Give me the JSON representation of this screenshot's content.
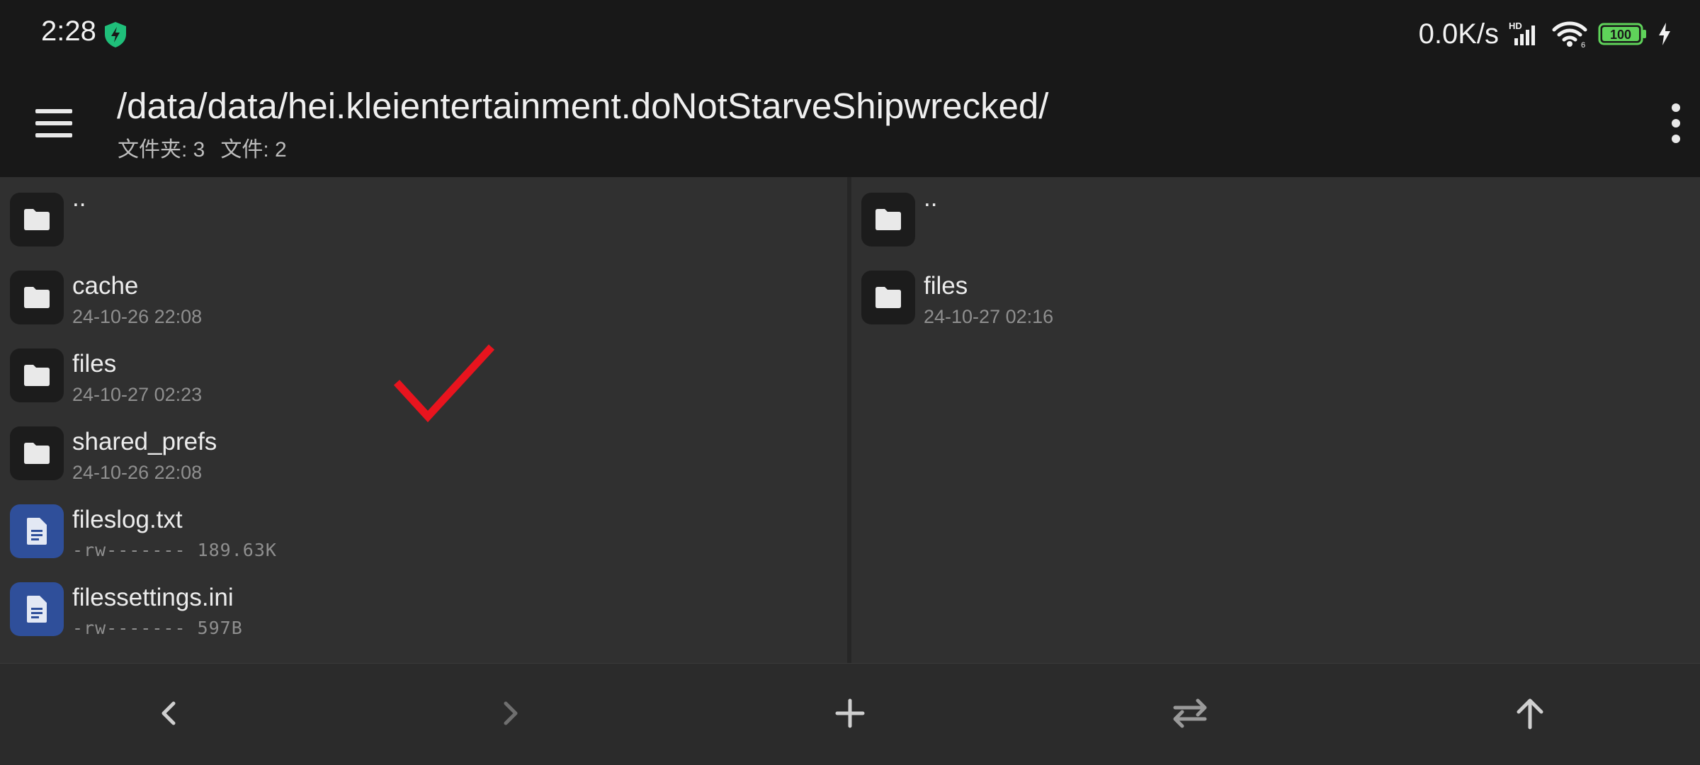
{
  "status_bar": {
    "time": "2:28",
    "shield_icon": "shield-bolt-icon",
    "network_speed": "0.0K/s",
    "signal_label": "HD",
    "battery_level": "100",
    "colors": {
      "shield": "#1fbf7a",
      "battery": "#5fd35a"
    }
  },
  "toolbar": {
    "menu_icon": "hamburger-menu-icon",
    "path": "/data/data/hei.kleientertainment.doNotStarveShipwrecked/",
    "folder_count": "文件夹: 3",
    "file_count": "文件: 2",
    "overflow_icon": "more-vertical-icon"
  },
  "left_pane": {
    "items": [
      {
        "name": "..",
        "meta": "",
        "type": "folder"
      },
      {
        "name": "cache",
        "meta": "24-10-26 22:08",
        "type": "folder"
      },
      {
        "name": "files",
        "meta": "24-10-27 02:23",
        "type": "folder"
      },
      {
        "name": "shared_prefs",
        "meta": "24-10-26 22:08",
        "type": "folder"
      },
      {
        "name": "fileslog.txt",
        "meta": "-rw------- 189.63K",
        "type": "file"
      },
      {
        "name": "filessettings.ini",
        "meta": "-rw------- 597B",
        "type": "file"
      }
    ]
  },
  "right_pane": {
    "items": [
      {
        "name": "..",
        "meta": "",
        "type": "folder"
      },
      {
        "name": "files",
        "meta": "24-10-27 02:16",
        "type": "folder"
      }
    ]
  },
  "annotation": {
    "icon": "red-checkmark-icon",
    "color": "#e8141e"
  },
  "bottom_bar": {
    "buttons": [
      "back-chevron-icon",
      "forward-chevron-icon",
      "add-icon",
      "swap-icon",
      "up-arrow-icon"
    ]
  }
}
